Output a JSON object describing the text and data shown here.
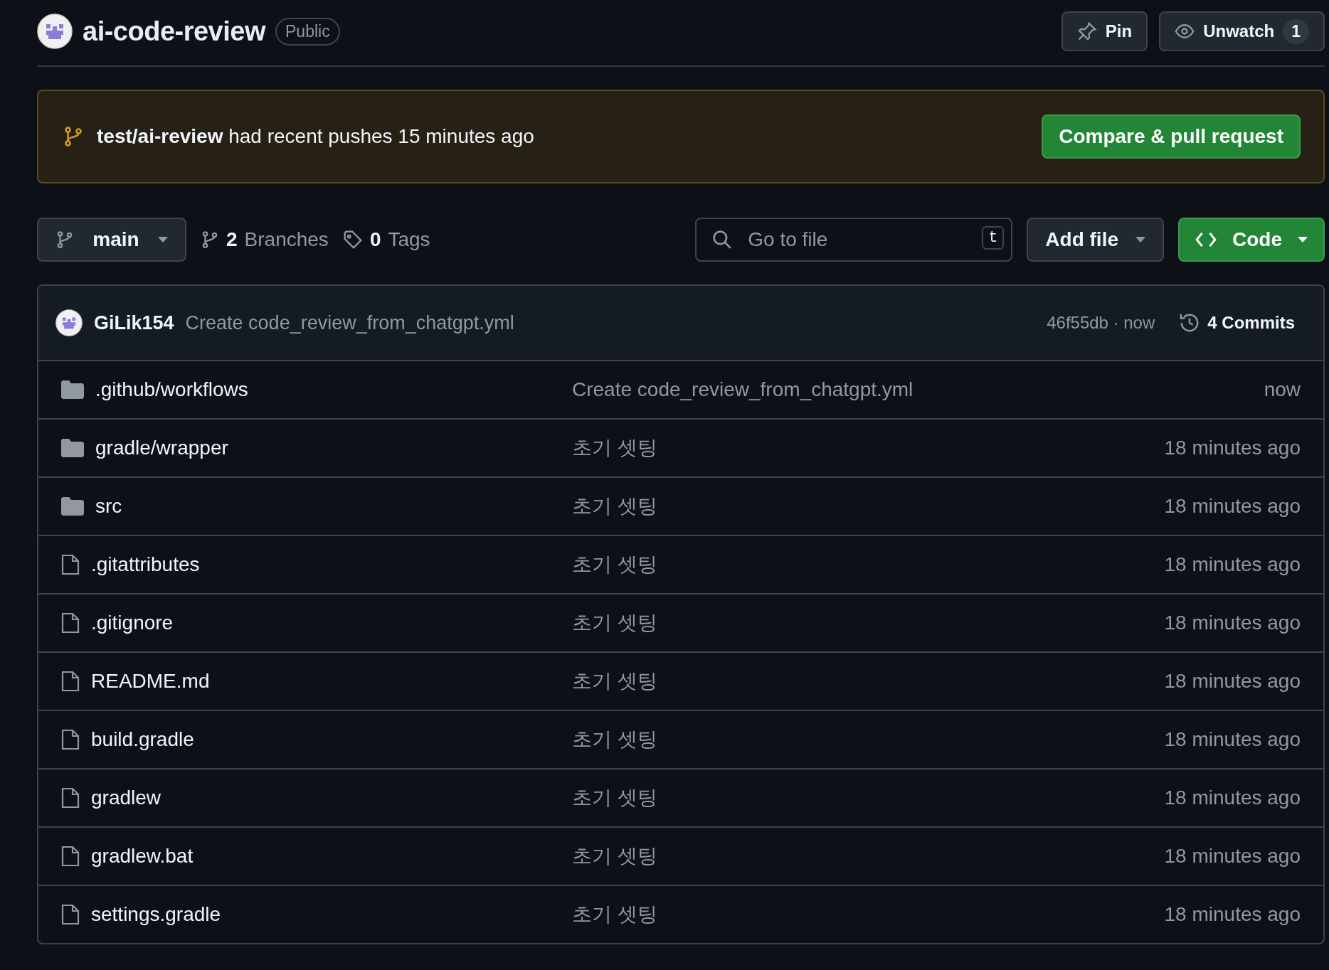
{
  "repo": {
    "name": "ai-code-review",
    "visibility": "Public"
  },
  "header_buttons": [
    {
      "kind": "pin",
      "label": "Pin"
    },
    {
      "kind": "watch",
      "label": "Unwatch",
      "count": "1"
    }
  ],
  "banner": {
    "text": "**test/ai-review** had recent pushes 15 minutes ago",
    "button": "Compare & pull request"
  },
  "toolbar": {
    "branch": "main",
    "branches_count": "2",
    "branches_label": "Branches",
    "tags_count": "0",
    "tags_label": "Tags",
    "search": {
      "placeholder": "Go to file",
      "shortcut": "t"
    },
    "add_file": "Add file",
    "code": "Code"
  },
  "commit": {
    "author": "GiLik154",
    "message": "Create code_review_from_chatgpt.yml",
    "sha": "46f55db · now",
    "commits": "4 Commits"
  },
  "files": [
    {
      "kind": "folder",
      "name": ".github/workflows",
      "message": "Create code_review_from_chatgpt.yml",
      "time": "now"
    },
    {
      "kind": "folder",
      "name": "gradle/wrapper",
      "message": "초기 셋팅",
      "time": "18 minutes ago"
    },
    {
      "kind": "folder",
      "name": "src",
      "message": "초기 셋팅",
      "time": "18 minutes ago"
    },
    {
      "kind": "file",
      "name": ".gitattributes",
      "message": "초기 셋팅",
      "time": "18 minutes ago"
    },
    {
      "kind": "file",
      "name": ".gitignore",
      "message": "초기 셋팅",
      "time": "18 minutes ago"
    },
    {
      "kind": "file",
      "name": "README.md",
      "message": "초기 셋팅",
      "time": "18 minutes ago"
    },
    {
      "kind": "file",
      "name": "build.gradle",
      "message": "초기 셋팅",
      "time": "18 minutes ago"
    },
    {
      "kind": "file",
      "name": "gradlew",
      "message": "초기 셋팅",
      "time": "18 minutes ago"
    },
    {
      "kind": "file",
      "name": "gradlew.bat",
      "message": "초기 셋팅",
      "time": "18 minutes ago"
    },
    {
      "kind": "file",
      "name": "settings.gradle",
      "message": "초기 셋팅",
      "time": "18 minutes ago"
    }
  ]
}
